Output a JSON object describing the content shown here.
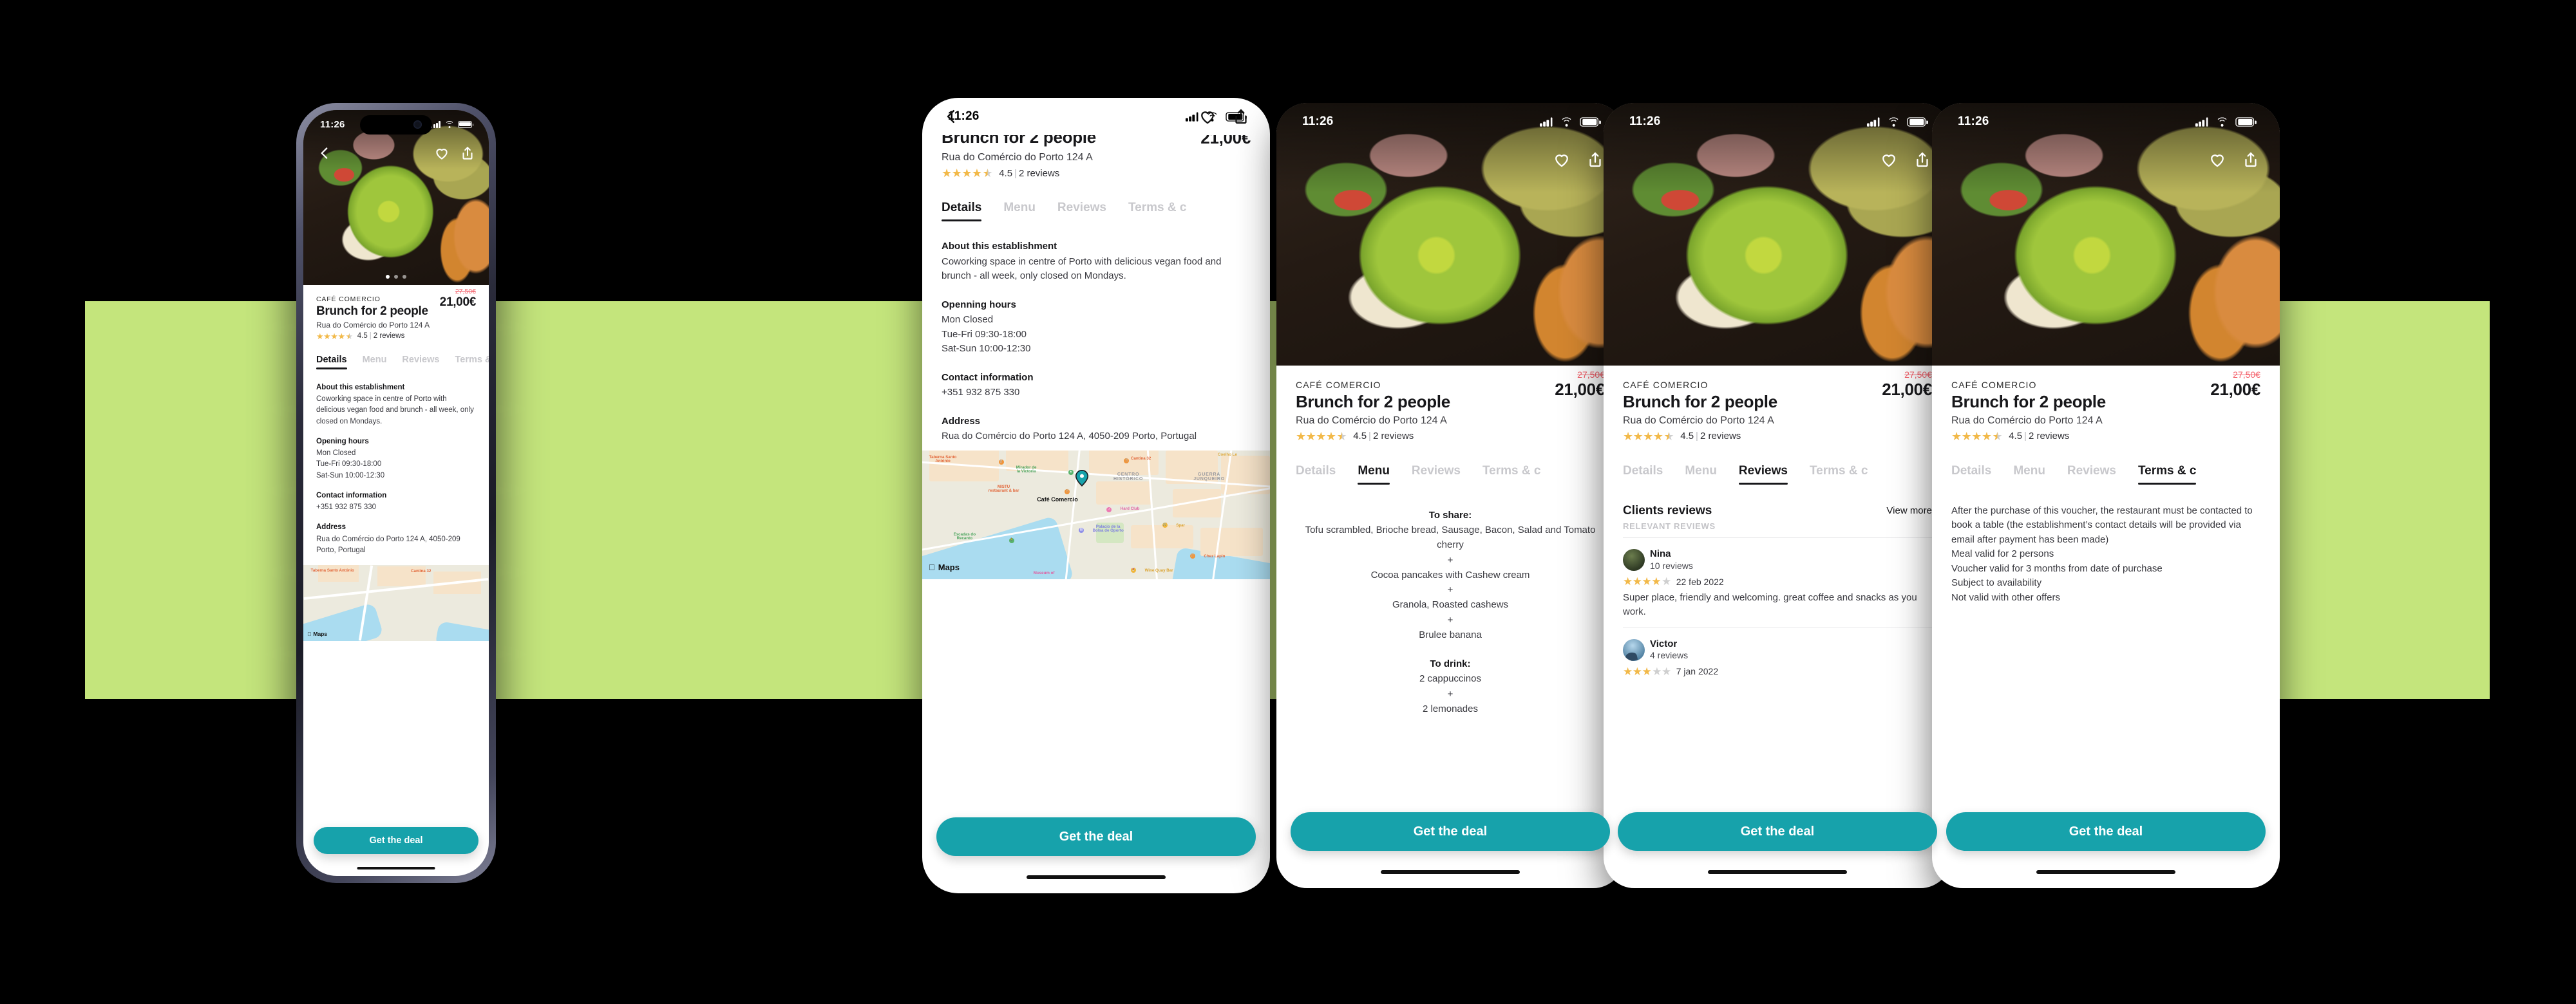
{
  "status_bar": {
    "time": "11:26",
    "signal_icon": "cellular-bars-icon",
    "wifi_icon": "wifi-icon",
    "battery_icon": "battery-icon"
  },
  "nav": {
    "back_icon": "chevron-left-icon",
    "favorite_icon": "heart-icon",
    "share_icon": "share-icon"
  },
  "listing": {
    "brand": "CAFÉ COMERCIO",
    "title": "Brunch for 2 people",
    "address_short": "Rua do Comércio do Porto 124 A",
    "price_old": "27,50€",
    "price_new": "21,00€",
    "rating_value": "4.5",
    "rating_separator": "|",
    "reviews_count": "2 reviews"
  },
  "tabs": [
    {
      "label": "Details"
    },
    {
      "label": "Menu"
    },
    {
      "label": "Reviews"
    },
    {
      "label": "Terms & c"
    },
    {
      "label": "Terms & conditions"
    }
  ],
  "details": {
    "about_heading": "About this establishment",
    "about_text": "Coworking space in centre of Porto with delicious vegan food and brunch - all week, only closed on Mondays.",
    "hours_heading": "Opening hours",
    "hours_heading_alt": "Openning hours",
    "hours": [
      "Mon Closed",
      "Tue-Fri 09:30-18:00",
      "Sat-Sun 10:00-12:30"
    ],
    "contact_heading": "Contact information",
    "contact_phone": "+351 932 875 330",
    "address_heading": "Address",
    "address_full": "Rua do Comércio do Porto 124 A, 4050-209 Porto, Portugal"
  },
  "map": {
    "attribution": "Maps",
    "pin_label": "Café Comercio",
    "labels": [
      "Taberna Santo António",
      "Mirador de la Victoria",
      "MISTU restaurant & bar",
      "Escadas do Recanto",
      "Cantina 32",
      "CENTRO HISTÓRICO",
      "GUERRA JUNQUEIRO",
      "Coelho Le",
      "Hard Club",
      "Palacio de la Bolsa de Oporto",
      "Spar",
      "Chez Lapin",
      "Wine Quay Bar",
      "Museum of"
    ]
  },
  "menu": {
    "share_heading": "To share:",
    "share_items": [
      "Tofu scrambled, Brioche bread, Sausage, Bacon, Salad and Tomato cherry",
      "Cocoa pancakes with Cashew cream",
      "Granola, Roasted cashews",
      "Brulee banana"
    ],
    "drink_heading": "To drink:",
    "drink_items": [
      "2 cappuccinos",
      "2 lemonades"
    ],
    "separator": "+"
  },
  "reviews": {
    "heading": "Clients reviews",
    "view_more": "View more",
    "subheading": "RELEVANT REVIEWS",
    "items": [
      {
        "name": "Nina",
        "count": "10 reviews",
        "stars": 4,
        "date": "22 feb 2022",
        "text": "Super place, friendly and welcoming.  great coffee and snacks as you work."
      },
      {
        "name": "Victor",
        "count": "4 reviews",
        "stars": 3,
        "date": "7 jan 2022",
        "text": ""
      }
    ]
  },
  "terms": {
    "lines": [
      "After the purchase of this voucher, the restaurant must be contacted to book a table (the establishment’s contact details will be provided via email after payment has been made)",
      "Meal valid for 2 persons",
      "Voucher valid for 3 months from date of purchase",
      "Subject to availability",
      "Not valid with other offers"
    ]
  },
  "cta": {
    "label": "Get the deal"
  },
  "colors": {
    "background": "#000000",
    "band_green": "#c4e57c",
    "accent_teal": "#17a2ab",
    "price_old_red": "#f4606a",
    "star_gold": "#f2b949",
    "text_dark": "#17171a"
  }
}
